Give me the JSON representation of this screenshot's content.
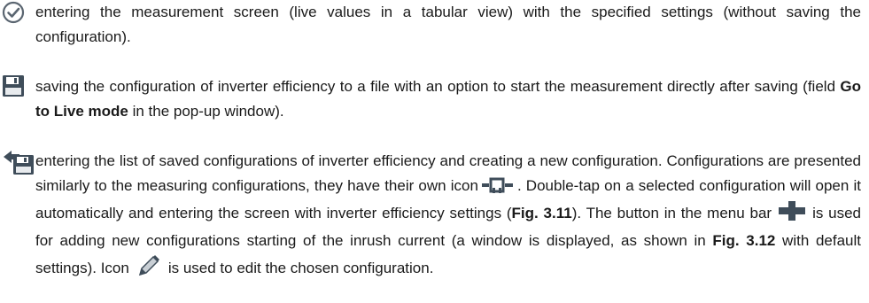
{
  "items": [
    {
      "icon": "checkmark-circle-icon",
      "text": "entering the measurement screen (live values in a tabular view) with the specified settings (without saving the configuration)."
    },
    {
      "icon": "floppy-disk-save-icon",
      "text_before": "saving the configuration of inverter efficiency to a file with an option to start the measurement directly after saving (field ",
      "bold": "Go to Live mode",
      "text_after": " in the pop-up window)."
    },
    {
      "icon": "back-arrow-save-icon",
      "seg1": "entering the list of saved configurations of inverter efficiency and creating a new configuration. Configurations are presented similarly to the measuring configurations, they have their own icon",
      "seg2": ". Double-tap on a selected configuration will open it automatically and entering the screen with inverter efficiency settings (",
      "fig1": "Fig. 3.11",
      "seg3": "). The button in the menu bar",
      "seg4": "is used for adding new configurations starting of the inrush current (a window is displayed, as shown in ",
      "fig2": "Fig. 3.12",
      "seg5": " with default settings). Icon",
      "seg6": "is used to edit the chosen configuration.",
      "inline_icons": [
        "configuration-icon",
        "plus-icon",
        "pencil-icon"
      ]
    }
  ],
  "colors": {
    "icon_dark": "#3f4d5a",
    "text": "#1a1a1a"
  }
}
